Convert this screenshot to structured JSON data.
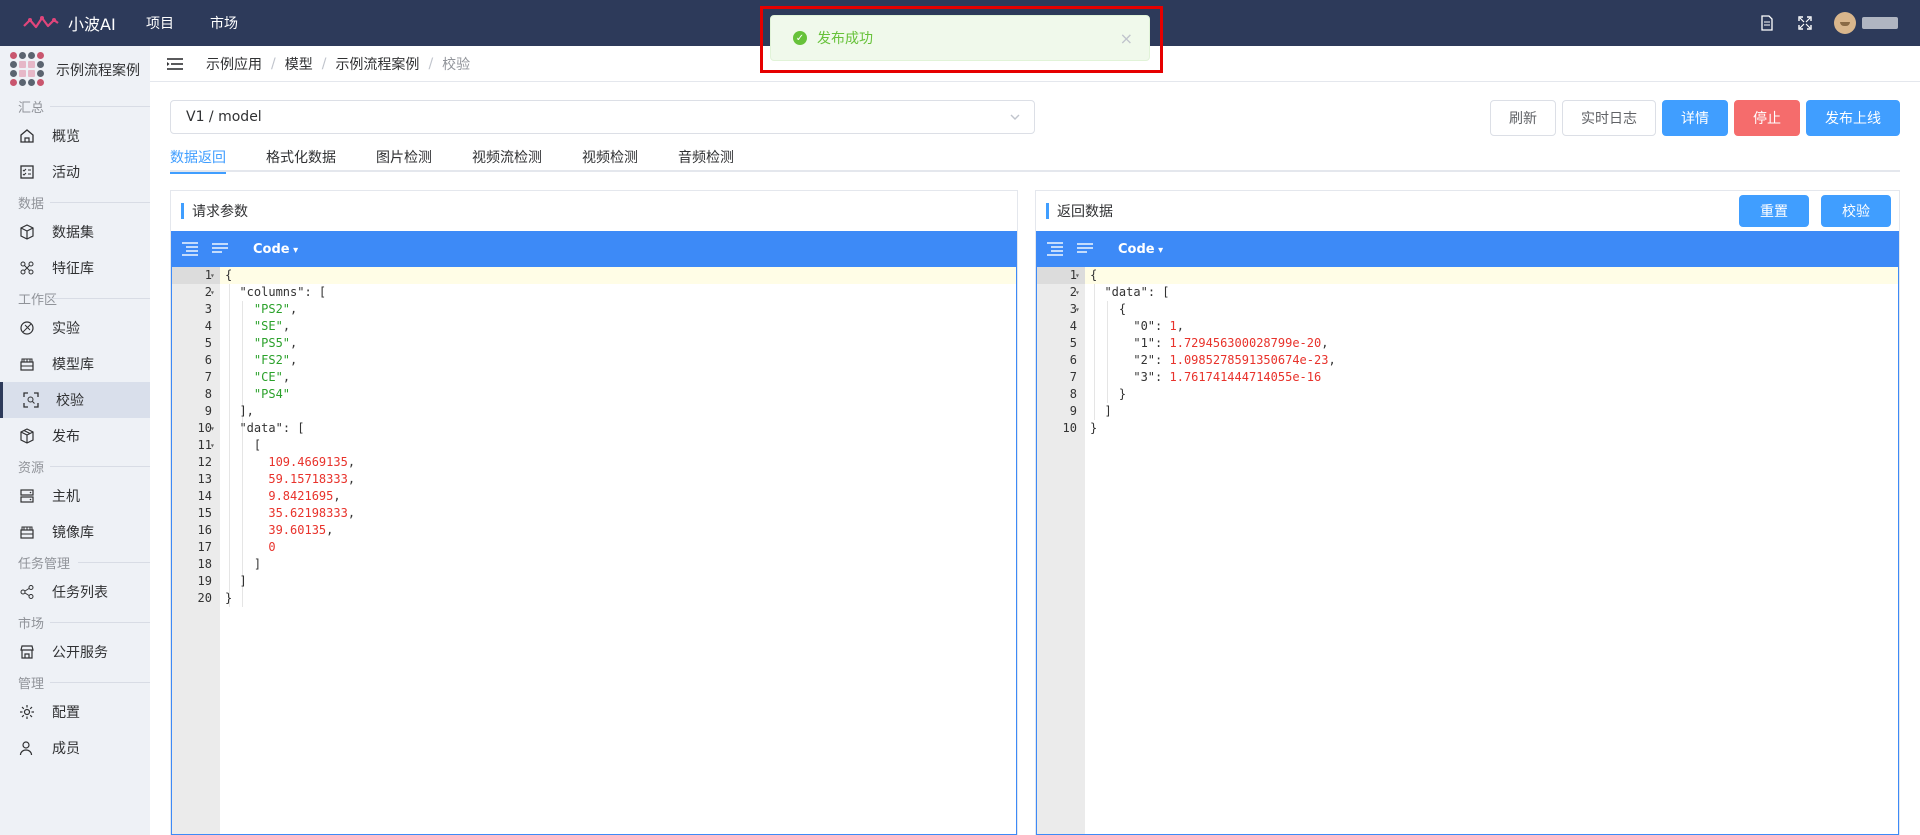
{
  "topbar": {
    "brand": "小波AI",
    "nav": [
      "项目",
      "市场"
    ],
    "colors": {
      "bg": "#2d3a5a",
      "brand_accent": "#e0457b"
    }
  },
  "toast": {
    "message": "发布成功",
    "type": "success"
  },
  "sidebar": {
    "project_name": "示例流程案例",
    "sections": [
      {
        "title": "汇总",
        "items": [
          {
            "label": "概览",
            "icon": "home-icon"
          },
          {
            "label": "活动",
            "icon": "activity-icon"
          }
        ]
      },
      {
        "title": "数据",
        "items": [
          {
            "label": "数据集",
            "icon": "cube-icon"
          },
          {
            "label": "特征库",
            "icon": "feature-icon"
          }
        ]
      },
      {
        "title": "工作区",
        "items": [
          {
            "label": "实验",
            "icon": "experiment-icon"
          },
          {
            "label": "模型库",
            "icon": "model-library-icon"
          },
          {
            "label": "校验",
            "icon": "scan-icon",
            "active": true
          },
          {
            "label": "发布",
            "icon": "box-icon"
          }
        ]
      },
      {
        "title": "资源",
        "items": [
          {
            "label": "主机",
            "icon": "server-icon"
          },
          {
            "label": "镜像库",
            "icon": "image-library-icon"
          }
        ]
      },
      {
        "title": "任务管理",
        "items": [
          {
            "label": "任务列表",
            "icon": "share-icon"
          }
        ]
      },
      {
        "title": "市场",
        "items": [
          {
            "label": "公开服务",
            "icon": "store-icon"
          }
        ]
      },
      {
        "title": "管理",
        "items": [
          {
            "label": "配置",
            "icon": "gear-icon"
          },
          {
            "label": "成员",
            "icon": "user-icon"
          }
        ]
      }
    ]
  },
  "breadcrumb": [
    "示例应用",
    "模型",
    "示例流程案例",
    "校验"
  ],
  "model_select": {
    "value": "V1 / model"
  },
  "actions": {
    "refresh": "刷新",
    "log": "实时日志",
    "detail": "详情",
    "stop": "停止",
    "publish": "发布上线"
  },
  "tabs": [
    "数据返回",
    "格式化数据",
    "图片检测",
    "视频流检测",
    "视频检测",
    "音频检测"
  ],
  "active_tab": 0,
  "request_panel": {
    "title": "请求参数",
    "mode": "Code",
    "lines": [
      [
        [
          "p",
          "{"
        ]
      ],
      [
        [
          "p",
          "  "
        ],
        [
          "k",
          "\"columns\""
        ],
        [
          "p",
          ": ["
        ]
      ],
      [
        [
          "p",
          "    "
        ],
        [
          "s",
          "\"PS2\""
        ],
        [
          "p",
          ","
        ]
      ],
      [
        [
          "p",
          "    "
        ],
        [
          "s",
          "\"SE\""
        ],
        [
          "p",
          ","
        ]
      ],
      [
        [
          "p",
          "    "
        ],
        [
          "s",
          "\"PS5\""
        ],
        [
          "p",
          ","
        ]
      ],
      [
        [
          "p",
          "    "
        ],
        [
          "s",
          "\"FS2\""
        ],
        [
          "p",
          ","
        ]
      ],
      [
        [
          "p",
          "    "
        ],
        [
          "s",
          "\"CE\""
        ],
        [
          "p",
          ","
        ]
      ],
      [
        [
          "p",
          "    "
        ],
        [
          "s",
          "\"PS4\""
        ]
      ],
      [
        [
          "p",
          "  ],"
        ]
      ],
      [
        [
          "p",
          "  "
        ],
        [
          "k",
          "\"data\""
        ],
        [
          "p",
          ": ["
        ]
      ],
      [
        [
          "p",
          "    ["
        ]
      ],
      [
        [
          "p",
          "      "
        ],
        [
          "n",
          "109.4669135"
        ],
        [
          "p",
          ","
        ]
      ],
      [
        [
          "p",
          "      "
        ],
        [
          "n",
          "59.15718333"
        ],
        [
          "p",
          ","
        ]
      ],
      [
        [
          "p",
          "      "
        ],
        [
          "n",
          "9.8421695"
        ],
        [
          "p",
          ","
        ]
      ],
      [
        [
          "p",
          "      "
        ],
        [
          "n",
          "35.62198333"
        ],
        [
          "p",
          ","
        ]
      ],
      [
        [
          "p",
          "      "
        ],
        [
          "n",
          "39.60135"
        ],
        [
          "p",
          ","
        ]
      ],
      [
        [
          "p",
          "      "
        ],
        [
          "n",
          "0"
        ]
      ],
      [
        [
          "p",
          "    ]"
        ]
      ],
      [
        [
          "p",
          "  ]"
        ]
      ],
      [
        [
          "p",
          "}"
        ]
      ]
    ],
    "folds": [
      1,
      2,
      10,
      11
    ]
  },
  "response_panel": {
    "title": "返回数据",
    "reset": "重置",
    "validate": "校验",
    "mode": "Code",
    "lines": [
      [
        [
          "p",
          "{"
        ]
      ],
      [
        [
          "p",
          "  "
        ],
        [
          "k",
          "\"data\""
        ],
        [
          "p",
          ": ["
        ]
      ],
      [
        [
          "p",
          "    {"
        ]
      ],
      [
        [
          "p",
          "      "
        ],
        [
          "k",
          "\"0\""
        ],
        [
          "p",
          ": "
        ],
        [
          "n",
          "1"
        ],
        [
          "p",
          ","
        ]
      ],
      [
        [
          "p",
          "      "
        ],
        [
          "k",
          "\"1\""
        ],
        [
          "p",
          ": "
        ],
        [
          "n",
          "1.729456300028799e-20"
        ],
        [
          "p",
          ","
        ]
      ],
      [
        [
          "p",
          "      "
        ],
        [
          "k",
          "\"2\""
        ],
        [
          "p",
          ": "
        ],
        [
          "n",
          "1.0985278591350674e-23"
        ],
        [
          "p",
          ","
        ]
      ],
      [
        [
          "p",
          "      "
        ],
        [
          "k",
          "\"3\""
        ],
        [
          "p",
          ": "
        ],
        [
          "n",
          "1.761741444714055e-16"
        ]
      ],
      [
        [
          "p",
          "    }"
        ]
      ],
      [
        [
          "p",
          "  ]"
        ]
      ],
      [
        [
          "p",
          "}"
        ]
      ]
    ],
    "folds": [
      1,
      2,
      3
    ]
  }
}
